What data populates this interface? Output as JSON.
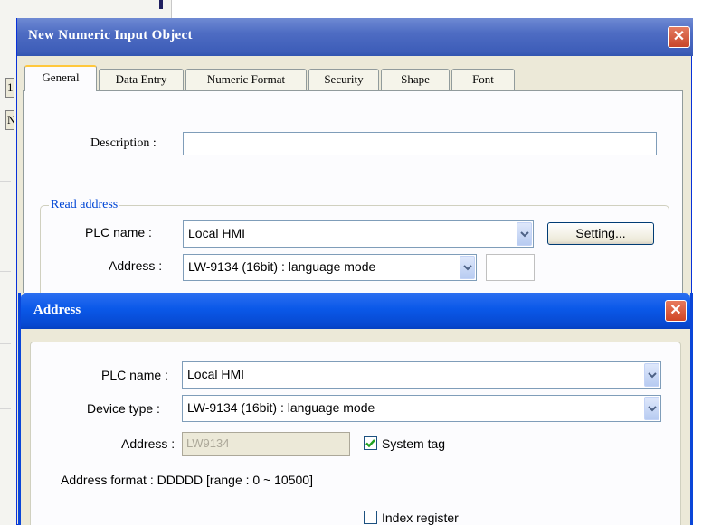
{
  "background_window": {
    "field_1_text": "1",
    "field_2_text": "N"
  },
  "main_dialog": {
    "title": "New  Numeric Input Object",
    "close_glyph": "✕",
    "tabs": [
      {
        "label": "General",
        "active": true
      },
      {
        "label": "Data Entry",
        "active": false
      },
      {
        "label": "Numeric Format",
        "active": false
      },
      {
        "label": "Security",
        "active": false
      },
      {
        "label": "Shape",
        "active": false
      },
      {
        "label": "Font",
        "active": false
      }
    ],
    "description_label": "Description :",
    "description_value": "",
    "read_address": {
      "group_title": "Read address",
      "plc_name_label": "PLC name :",
      "plc_name_value": "Local HMI",
      "setting_button": "Setting...",
      "address_label": "Address :",
      "address_value": "LW-9134 (16bit) : language mode",
      "address_extra_value": ""
    }
  },
  "address_dialog": {
    "title": "Address",
    "close_glyph": "✕",
    "plc_name_label": "PLC name :",
    "plc_name_value": "Local HMI",
    "device_type_label": "Device type :",
    "device_type_value": "LW-9134 (16bit) : language mode",
    "address_label": "Address :",
    "address_value": "LW9134",
    "system_tag_label": "System tag",
    "system_tag_checked": true,
    "address_format_text": "Address format : DDDDD [range : 0 ~ 10500]",
    "index_register_label": "Index register",
    "index_register_checked": false
  },
  "colors": {
    "title_bar_inactive": "#4e6cc3",
    "title_bar_active": "#0a58e8",
    "close_button": "#c8462a",
    "group_title": "#0046d5"
  }
}
